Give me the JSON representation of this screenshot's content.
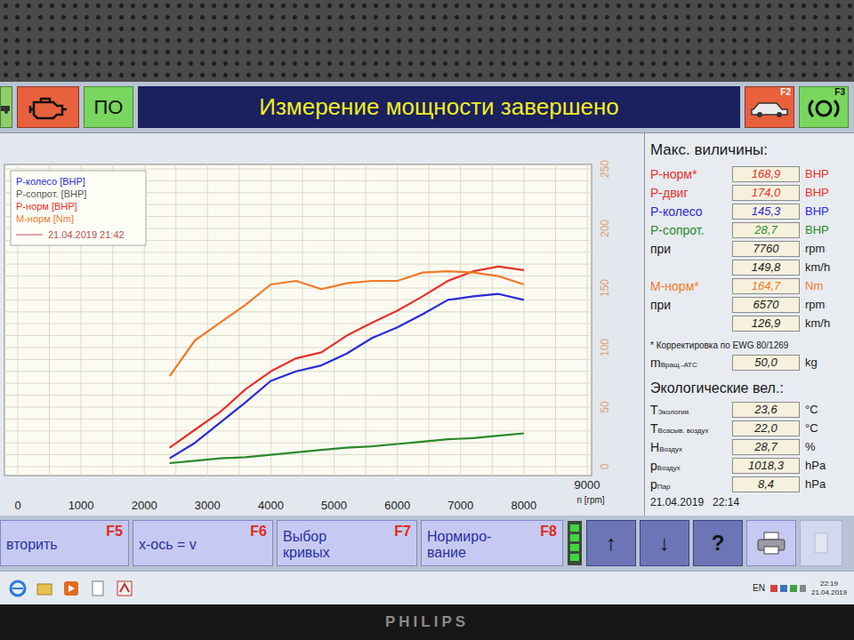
{
  "header": {
    "po": "ПО",
    "title": "Измерение мощности завершено",
    "f2": "F2",
    "f3": "F3"
  },
  "chart": {
    "legend": [
      {
        "label": "Р-колесо [BHP]",
        "color": "#2a2ad8"
      },
      {
        "label": "Р-сопрот. [BHP]",
        "color": "#555555"
      },
      {
        "label": "Р-норм [BHP]",
        "color": "#e8302a"
      },
      {
        "label": "М-норм [Nm]",
        "color": "#f07a28"
      }
    ],
    "run": {
      "label": "21.04.2019 21:42",
      "color": "#c0504a"
    },
    "x_ticks": [
      "0",
      "1000",
      "2000",
      "3000",
      "4000",
      "5000",
      "6000",
      "7000",
      "8000",
      "9000"
    ],
    "x_unit": "n [rpm]",
    "y_ticks": [
      "0",
      "50",
      "100",
      "150",
      "200",
      "250"
    ],
    "rpm": [
      2400,
      2800,
      3200,
      3600,
      4000,
      4400,
      4800,
      5200,
      5600,
      6000,
      6400,
      6800,
      7200,
      7600,
      8000
    ],
    "series": [
      {
        "name": "Р-колесо",
        "color": "#2a2ad8",
        "values": [
          7,
          20,
          37,
          54,
          72,
          80,
          85,
          95,
          108,
          117,
          128,
          140,
          143,
          145,
          140
        ]
      },
      {
        "name": "Р-сопрот.",
        "color": "#2a8a2a",
        "values": [
          3,
          5,
          7,
          8,
          10,
          12,
          14,
          16,
          17,
          19,
          21,
          23,
          24,
          26,
          28
        ]
      },
      {
        "name": "Р-норм",
        "color": "#e8302a",
        "values": [
          16,
          31,
          46,
          65,
          80,
          91,
          96,
          110,
          121,
          131,
          143,
          156,
          164,
          168,
          165
        ]
      },
      {
        "name": "М-норм",
        "color": "#f07a28",
        "values": [
          76,
          106,
          121,
          136,
          153,
          156,
          149,
          154,
          156,
          156,
          163,
          164,
          163,
          160,
          153
        ]
      }
    ]
  },
  "max_values": {
    "title": "Макс. виличины:",
    "rows": [
      {
        "label": "Р-норм*",
        "value": "168,9",
        "unit": "BHP",
        "color": "#e8302a"
      },
      {
        "label": "Р-двиг",
        "value": "174,0",
        "unit": "BHP",
        "color": "#e8302a"
      },
      {
        "label": "Р-колесо",
        "value": "145,3",
        "unit": "BHP",
        "color": "#2a2ad8"
      },
      {
        "label": "Р-сопрот.",
        "value": "28,7",
        "unit": "BHP",
        "color": "#2a8a2a"
      },
      {
        "label": "при",
        "value": "7760",
        "unit": "rpm",
        "color": "#1a1a1a"
      },
      {
        "value": "149,8",
        "unit": "km/h",
        "color": "#1a1a1a"
      },
      {
        "label": "М-норм*",
        "value": "164,7",
        "unit": "Nm",
        "color": "#f07a28"
      },
      {
        "label": "при",
        "value": "6570",
        "unit": "rpm",
        "color": "#1a1a1a"
      },
      {
        "value": "126,9",
        "unit": "km/h",
        "color": "#1a1a1a"
      }
    ]
  },
  "note": "* Корректировка по EWG 80/1269",
  "mass": {
    "label": "m",
    "sub": "Вращ.-АТС",
    "value": "50,0",
    "unit": "kg"
  },
  "eco": {
    "title": "Экологические вел.:",
    "rows": [
      {
        "label": "T",
        "sub": "Экология",
        "value": "23,6",
        "unit": "°C"
      },
      {
        "label": "T",
        "sub": "Всасыв. воздух",
        "value": "22,0",
        "unit": "°C"
      },
      {
        "label": "H",
        "sub": "Воздух",
        "value": "28,7",
        "unit": "%"
      },
      {
        "label": "p",
        "sub": "Воздух",
        "value": "1018,3",
        "unit": "hPa"
      },
      {
        "label": "p",
        "sub": "Пар",
        "value": "8,4",
        "unit": "hPa"
      }
    ]
  },
  "timestamp": "21.04.2019   22:14",
  "function_keys": [
    {
      "lines": [
        "вторить"
      ],
      "key": "F5"
    },
    {
      "lines": [
        "x-ось = v"
      ],
      "key": "F6"
    },
    {
      "lines": [
        "Выбор",
        "кривых"
      ],
      "key": "F7"
    },
    {
      "lines": [
        "Нормиро-",
        "вание"
      ],
      "key": "F8"
    }
  ],
  "nav_buttons": [
    {
      "label": "↑"
    },
    {
      "label": "↓"
    },
    {
      "label": "?"
    }
  ],
  "taskbar": {
    "lang": "EN",
    "time": "22:19",
    "date": "21.04.2019"
  },
  "bezel": {
    "brand": "PHILIPS"
  }
}
